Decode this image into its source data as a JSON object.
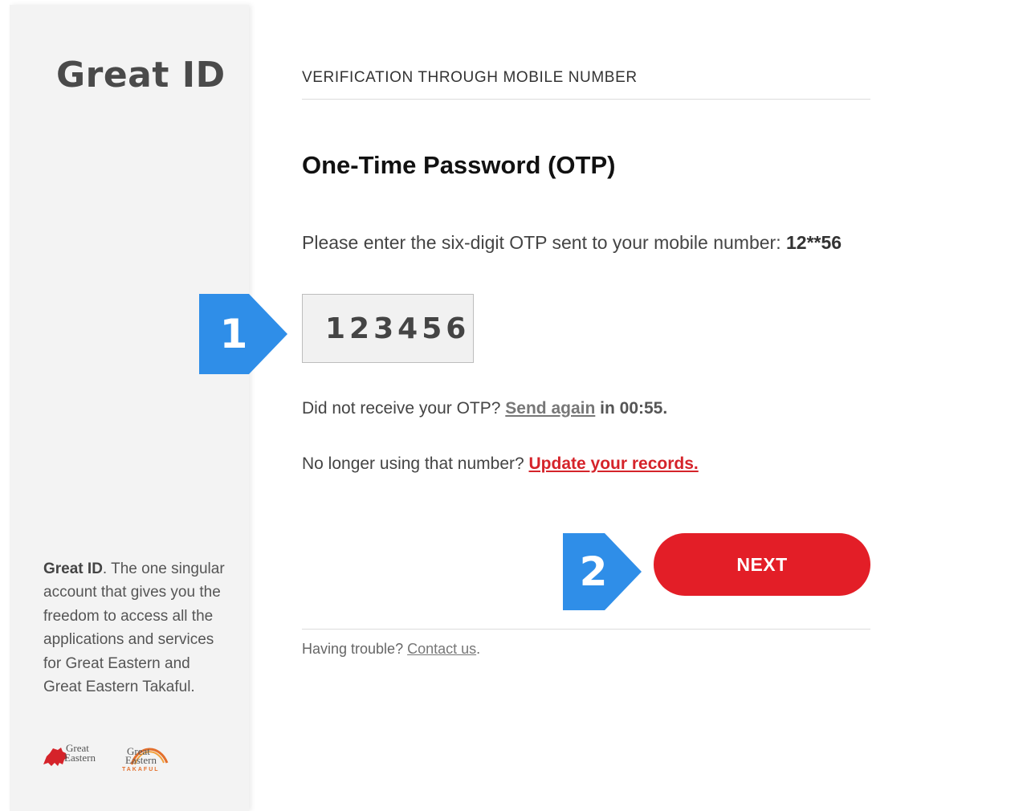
{
  "sidebar": {
    "brand_title": "Great ID",
    "blurb_brand": "Great ID",
    "blurb_text": ". The one singular account that gives you the freedom to access all the applications and services for Great Eastern and Great Eastern Takaful.",
    "logos": [
      {
        "name": "great-eastern-logo",
        "line1": "Great",
        "line2": "Eastern"
      },
      {
        "name": "great-eastern-takaful-logo",
        "line1": "Great",
        "line2": "Eastern",
        "line3": "TAKAFUL"
      }
    ]
  },
  "main": {
    "section_label": "VERIFICATION THROUGH MOBILE NUMBER",
    "title": "One-Time Password (OTP)",
    "instruction_prefix": "Please enter the six-digit OTP sent to your mobile number: ",
    "masked_number": "12**56",
    "otp_value": "123456",
    "resend_prefix": "Did not receive your OTP? ",
    "resend_link": "Send again",
    "resend_suffix": " in 00:55.",
    "records_prefix": "No longer using that number? ",
    "records_link": "Update your records.",
    "next_label": "NEXT",
    "trouble_prefix": "Having trouble? ",
    "contact_link": "Contact us",
    "trouble_suffix": "."
  },
  "annotations": [
    {
      "label": "1",
      "color": "#2f8ee8"
    },
    {
      "label": "2",
      "color": "#2f8ee8"
    }
  ],
  "colors": {
    "accent_red": "#e31e27",
    "link_red": "#d5232a",
    "marker_blue": "#2f8ee8",
    "sidebar_bg": "#f3f3f3"
  }
}
